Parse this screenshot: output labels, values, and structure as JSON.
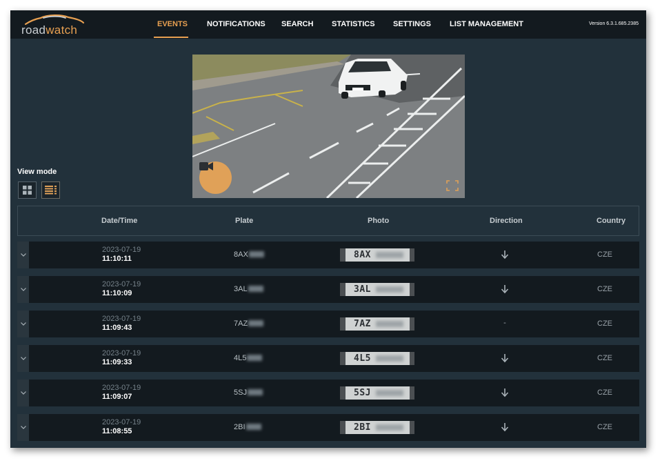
{
  "app": {
    "logo_text_main": "road",
    "logo_text_accent": "watch",
    "version": "Version 6.3.1.685.2385"
  },
  "nav": {
    "items": [
      {
        "label": "EVENTS",
        "active": true
      },
      {
        "label": "NOTIFICATIONS",
        "active": false
      },
      {
        "label": "SEARCH",
        "active": false
      },
      {
        "label": "STATISTICS",
        "active": false
      },
      {
        "label": "SETTINGS",
        "active": false
      },
      {
        "label": "LIST MANAGEMENT",
        "active": false
      }
    ]
  },
  "camera": {
    "video_icon": "video-camera-icon",
    "fullscreen_icon": "fullscreen-icon"
  },
  "view_mode": {
    "label": "View mode",
    "options": [
      {
        "icon": "grid-view-icon",
        "active": false
      },
      {
        "icon": "list-view-icon",
        "active": true
      }
    ]
  },
  "table": {
    "columns": [
      "Date/Time",
      "Plate",
      "Photo",
      "Direction",
      "Country"
    ],
    "rows": [
      {
        "date": "2023-07-19",
        "time": "11:10:11",
        "plate": "8AX",
        "photo_text": "8AX",
        "direction": "arrow-down",
        "country": "CZE"
      },
      {
        "date": "2023-07-19",
        "time": "11:10:09",
        "plate": "3AL",
        "photo_text": "3AL",
        "direction": "arrow-down",
        "country": "CZE"
      },
      {
        "date": "2023-07-19",
        "time": "11:09:43",
        "plate": "7AZ",
        "photo_text": "7AZ",
        "direction": "-",
        "country": "CZE"
      },
      {
        "date": "2023-07-19",
        "time": "11:09:33",
        "plate": "4L5",
        "photo_text": "4L5",
        "direction": "arrow-down",
        "country": "CZE"
      },
      {
        "date": "2023-07-19",
        "time": "11:09:07",
        "plate": "5SJ",
        "photo_text": "5SJ",
        "direction": "arrow-down",
        "country": "CZE"
      },
      {
        "date": "2023-07-19",
        "time": "11:08:55",
        "plate": "2BI",
        "photo_text": "2BI",
        "direction": "arrow-down",
        "country": "CZE"
      }
    ]
  },
  "colors": {
    "accent": "#e8a051",
    "background": "#22313b",
    "topbar": "#131a1f",
    "row": "#131a1f"
  }
}
